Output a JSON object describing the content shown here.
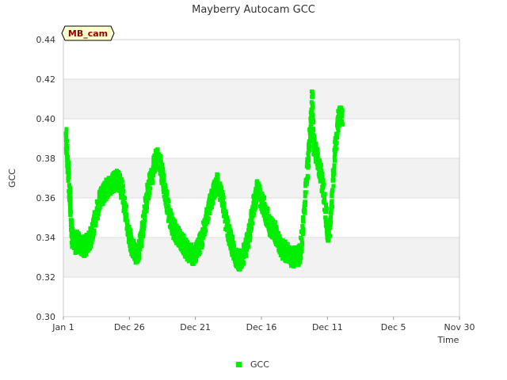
{
  "chart_data": {
    "type": "scatter",
    "title": "Mayberry Autocam GCC",
    "xlabel": "Time",
    "ylabel": "GCC",
    "ylim": [
      0.3,
      0.44
    ],
    "yticks": [
      "0.30",
      "0.32",
      "0.34",
      "0.36",
      "0.38",
      "0.40",
      "0.42",
      "0.44"
    ],
    "xticks": [
      "Jan 1",
      "Dec 26",
      "Dec 21",
      "Dec 16",
      "Dec 11",
      "Dec 5",
      "Nov 30"
    ],
    "grid": true,
    "x_axis_reversed": true,
    "legend_position": "bottom",
    "badge": "MB_cam",
    "colors": {
      "series": "#00ee00",
      "band": "#f2f2f2",
      "badge_bg": "#ffffcc",
      "badge_text": "#8b0000"
    },
    "series": [
      {
        "name": "GCC",
        "x_unit": "days before Jan 1",
        "points": [
          [
            6.8,
            0.392
          ],
          [
            6.7,
            0.38
          ],
          [
            6.6,
            0.372
          ],
          [
            6.5,
            0.36
          ],
          [
            6.4,
            0.348
          ],
          [
            6.3,
            0.34
          ],
          [
            6.1,
            0.336
          ],
          [
            5.9,
            0.338
          ],
          [
            5.7,
            0.337
          ],
          [
            5.5,
            0.335
          ],
          [
            5.3,
            0.336
          ],
          [
            5.1,
            0.337
          ],
          [
            4.9,
            0.339
          ],
          [
            4.7,
            0.344
          ],
          [
            4.5,
            0.35
          ],
          [
            4.3,
            0.356
          ],
          [
            4.1,
            0.36
          ],
          [
            3.9,
            0.362
          ],
          [
            3.7,
            0.364
          ],
          [
            3.5,
            0.366
          ],
          [
            3.3,
            0.367
          ],
          [
            3.1,
            0.368
          ],
          [
            2.9,
            0.369
          ],
          [
            2.7,
            0.369
          ],
          [
            2.5,
            0.366
          ],
          [
            2.3,
            0.36
          ],
          [
            2.1,
            0.35
          ],
          [
            1.9,
            0.342
          ],
          [
            1.7,
            0.337
          ],
          [
            1.5,
            0.334
          ],
          [
            1.3,
            0.331
          ],
          [
            1.1,
            0.334
          ],
          [
            0.9,
            0.34
          ],
          [
            0.7,
            0.35
          ],
          [
            0.5,
            0.36
          ],
          [
            0.3,
            0.367
          ],
          [
            0.1,
            0.372
          ],
          [
            -0.1,
            0.378
          ],
          [
            -0.3,
            0.381
          ],
          [
            -0.5,
            0.378
          ],
          [
            -0.7,
            0.372
          ],
          [
            -0.9,
            0.364
          ],
          [
            -1.1,
            0.356
          ],
          [
            -1.3,
            0.35
          ],
          [
            -1.5,
            0.346
          ],
          [
            -1.7,
            0.343
          ],
          [
            -1.9,
            0.341
          ],
          [
            -2.1,
            0.339
          ],
          [
            -2.3,
            0.337
          ],
          [
            -2.5,
            0.335
          ],
          [
            -2.7,
            0.333
          ],
          [
            -2.9,
            0.332
          ],
          [
            -3.1,
            0.331
          ],
          [
            -3.3,
            0.332
          ],
          [
            -3.5,
            0.334
          ],
          [
            -3.7,
            0.337
          ],
          [
            -3.9,
            0.342
          ],
          [
            -4.1,
            0.348
          ],
          [
            -4.3,
            0.354
          ],
          [
            -4.5,
            0.359
          ],
          [
            -4.7,
            0.363
          ],
          [
            -4.9,
            0.366
          ],
          [
            -5.0,
            0.368
          ],
          [
            -5.3,
            0.362
          ],
          [
            -5.5,
            0.355
          ],
          [
            -5.7,
            0.348
          ],
          [
            -5.9,
            0.342
          ],
          [
            -6.1,
            0.337
          ],
          [
            -6.3,
            0.333
          ],
          [
            -6.5,
            0.33
          ],
          [
            -6.7,
            0.328
          ],
          [
            -6.9,
            0.33
          ],
          [
            -7.1,
            0.332
          ],
          [
            -7.3,
            0.336
          ],
          [
            -7.5,
            0.342
          ],
          [
            -7.7,
            0.35
          ],
          [
            -7.9,
            0.358
          ],
          [
            -8.1,
            0.364
          ],
          [
            -8.3,
            0.362
          ],
          [
            -8.5,
            0.358
          ],
          [
            -8.7,
            0.354
          ],
          [
            -8.9,
            0.35
          ],
          [
            -9.1,
            0.346
          ],
          [
            -9.3,
            0.344
          ],
          [
            -9.5,
            0.343
          ],
          [
            -9.7,
            0.34
          ],
          [
            -9.9,
            0.336
          ],
          [
            -10.1,
            0.334
          ],
          [
            -10.3,
            0.333
          ],
          [
            -10.5,
            0.332
          ],
          [
            -10.7,
            0.33
          ],
          [
            -10.9,
            0.33
          ],
          [
            -11.1,
            0.331
          ],
          [
            -11.3,
            0.33
          ],
          [
            -11.5,
            0.333
          ],
          [
            -11.7,
            0.345
          ],
          [
            -11.9,
            0.365
          ],
          [
            -12.1,
            0.38
          ],
          [
            -12.3,
            0.395
          ],
          [
            -12.4,
            0.412
          ],
          [
            -12.5,
            0.388
          ],
          [
            -12.7,
            0.382
          ],
          [
            -12.9,
            0.378
          ],
          [
            -13.1,
            0.372
          ],
          [
            -13.3,
            0.362
          ],
          [
            -13.5,
            0.35
          ],
          [
            -13.6,
            0.342
          ],
          [
            -13.8,
            0.345
          ],
          [
            -14.0,
            0.365
          ],
          [
            -14.2,
            0.385
          ],
          [
            -14.4,
            0.398
          ],
          [
            -14.6,
            0.402
          ],
          [
            -14.8,
            0.4
          ]
        ]
      }
    ]
  }
}
